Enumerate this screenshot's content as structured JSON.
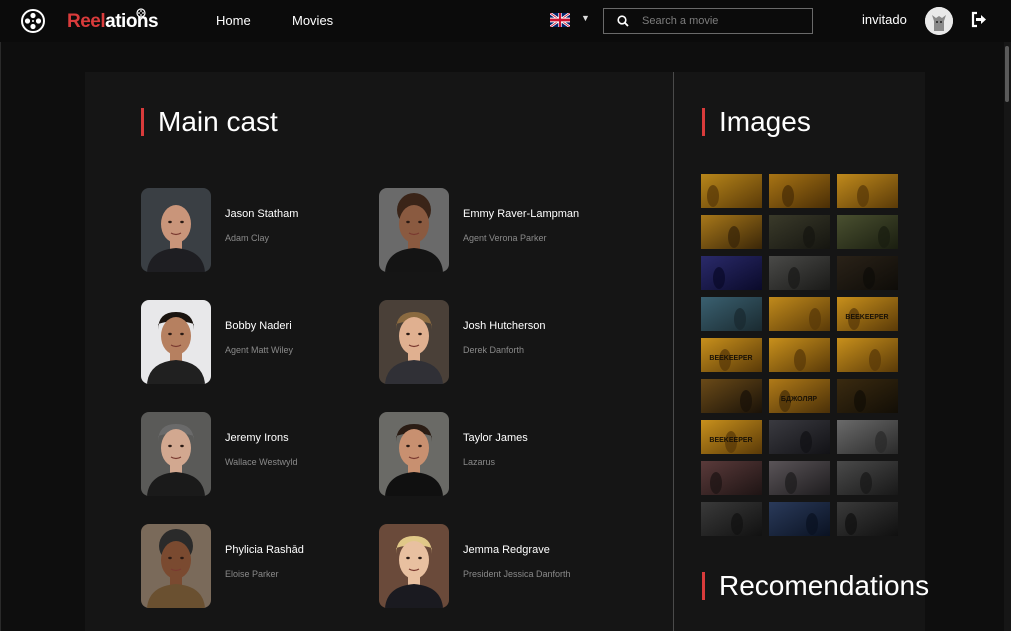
{
  "brand": {
    "part1": "Reel",
    "part2": "ations"
  },
  "nav": {
    "home": "Home",
    "movies": "Movies"
  },
  "search": {
    "placeholder": "Search a movie"
  },
  "user": {
    "name": "invitado"
  },
  "sections": {
    "cast_title": "Main cast",
    "images_title": "Images",
    "recommendations_title": "Recomendations"
  },
  "colors": {
    "accent": "#d93b3b",
    "panel": "#151515",
    "background": "#0e0e0e"
  },
  "icons": {
    "logo": "film-reel-icon",
    "language": "uk-flag-icon",
    "search": "search-icon",
    "logout": "logout-icon"
  },
  "cast": [
    {
      "name": "Jason Statham",
      "role": "Adam Clay"
    },
    {
      "name": "Emmy Raver-Lampman",
      "role": "Agent Verona Parker"
    },
    {
      "name": "Bobby Naderi",
      "role": "Agent Matt Wiley"
    },
    {
      "name": "Josh Hutcherson",
      "role": "Derek Danforth"
    },
    {
      "name": "Jeremy Irons",
      "role": "Wallace Westwyld"
    },
    {
      "name": "Taylor James",
      "role": "Lazarus"
    },
    {
      "name": "Phylicia Rashād",
      "role": "Eloise Parker"
    },
    {
      "name": "Jemma Redgrave",
      "role": "President Jessica Danforth"
    }
  ],
  "image_thumbs": [
    {
      "tone": "#b8861a",
      "dark": "#5a3a08",
      "text": ""
    },
    {
      "tone": "#a87414",
      "dark": "#4a2e06",
      "text": ""
    },
    {
      "tone": "#c08a1c",
      "dark": "#5a3a08",
      "text": ""
    },
    {
      "tone": "#a8781a",
      "dark": "#3a2608",
      "text": ""
    },
    {
      "tone": "#3a3a2a",
      "dark": "#151510",
      "text": ""
    },
    {
      "tone": "#4a5030",
      "dark": "#1a1e10",
      "text": ""
    },
    {
      "tone": "#2a2a6a",
      "dark": "#0a0a2a",
      "text": ""
    },
    {
      "tone": "#4a4a48",
      "dark": "#1a1a18",
      "text": ""
    },
    {
      "tone": "#2a2218",
      "dark": "#0e0c08",
      "text": ""
    },
    {
      "tone": "#3a6070",
      "dark": "#1a2a30",
      "text": ""
    },
    {
      "tone": "#c08a1c",
      "dark": "#5a3a08",
      "text": ""
    },
    {
      "tone": "#c8901c",
      "dark": "#5a3a08",
      "text": "BEEKEEPER"
    },
    {
      "tone": "#c8901c",
      "dark": "#5a3a08",
      "text": "BEEKEEPER"
    },
    {
      "tone": "#c8901c",
      "dark": "#5a3a08",
      "text": ""
    },
    {
      "tone": "#c8901c",
      "dark": "#5a3a08",
      "text": ""
    },
    {
      "tone": "#6a4a18",
      "dark": "#1a1208",
      "text": ""
    },
    {
      "tone": "#b07a18",
      "dark": "#4a3008",
      "text": "БДЖОЛЯР"
    },
    {
      "tone": "#3a2a10",
      "dark": "#120e06",
      "text": ""
    },
    {
      "tone": "#c8901c",
      "dark": "#5a3a08",
      "text": "BEEKEEPER"
    },
    {
      "tone": "#3a3a40",
      "dark": "#121216",
      "text": ""
    },
    {
      "tone": "#6a6a6a",
      "dark": "#2a2a2a",
      "text": ""
    },
    {
      "tone": "#5a3a3a",
      "dark": "#1e1414",
      "text": ""
    },
    {
      "tone": "#5a5458",
      "dark": "#1e1c1e",
      "text": ""
    },
    {
      "tone": "#4a4a4a",
      "dark": "#181818",
      "text": ""
    },
    {
      "tone": "#3a3a3a",
      "dark": "#111111",
      "text": ""
    },
    {
      "tone": "#2a3a5a",
      "dark": "#0a1222",
      "text": ""
    },
    {
      "tone": "#3a3a3a",
      "dark": "#101010",
      "text": ""
    }
  ]
}
